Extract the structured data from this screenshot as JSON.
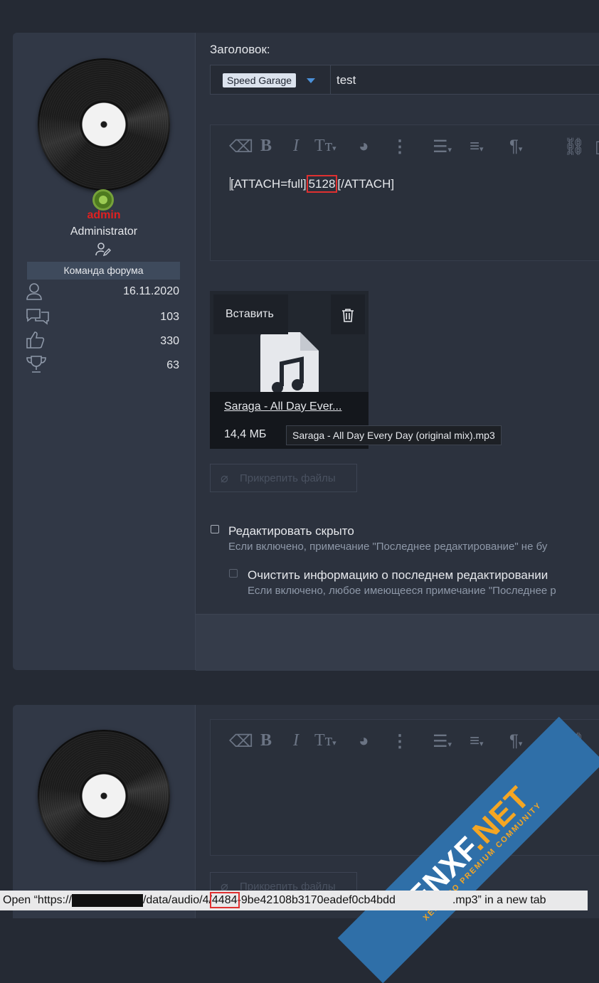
{
  "post1": {
    "title_label": "Заголовок:",
    "prefix": "Speed Garage",
    "title_value": "test",
    "editor_content": {
      "before": "[ATTACH=full]",
      "id": "5128",
      "after": "[/ATTACH]"
    },
    "attachment": {
      "insert_label": "Вставить",
      "file_name": "Saraga - All Day Ever...",
      "file_size": "14,4 МБ",
      "tooltip": "Saraga - All Day Every Day (original mix).mp3"
    },
    "attach_files_label": "Прикрепить файлы",
    "options": [
      {
        "label": "Редактировать скрыто",
        "hint": "Если включено, примечание \"Последнее редактирование\" не бу"
      },
      {
        "label": "Очистить информацию о последнем редактировании",
        "hint": "Если включено, любое имеющееся примечание \"Последнее р"
      }
    ]
  },
  "user": {
    "name": "admin",
    "title": "Administrator",
    "banner": "Команда форума",
    "stats": [
      {
        "icon": "user-icon",
        "value": "16.11.2020"
      },
      {
        "icon": "messages-icon",
        "value": "103"
      },
      {
        "icon": "thumbs-up-icon",
        "value": "330"
      },
      {
        "icon": "trophy-icon",
        "value": "63"
      }
    ]
  },
  "post2": {
    "attach_files_label": "Прикрепить файлы"
  },
  "statusbar": {
    "prefix": "Open “https://",
    "path1": "/data/audio/4/",
    "id": "4484",
    "path2": "-9be42108b3170eadef0cb4bdd",
    "suffix": ".mp3” in a new tab"
  },
  "watermark": {
    "brand": "ENXF",
    "tld": ".NET",
    "tagline": "XENFORO PREMIUM COMMUNITY"
  }
}
